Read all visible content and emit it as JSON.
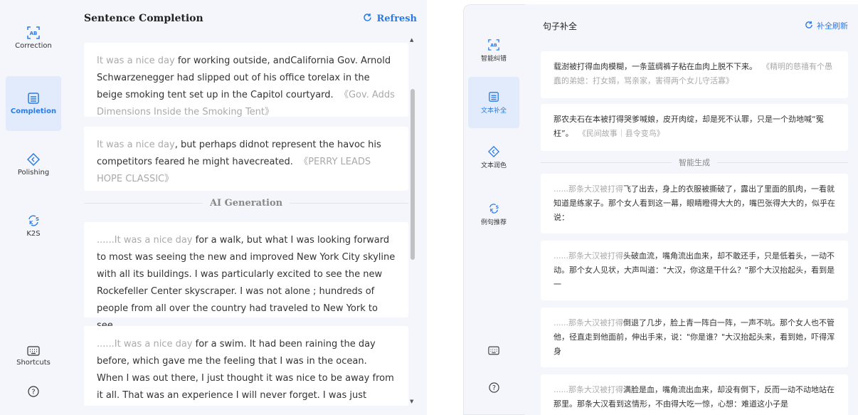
{
  "left": {
    "sidebar": {
      "items": [
        {
          "label": "Correction",
          "icon": "ab-text-icon"
        },
        {
          "label": "Completion",
          "icon": "document-icon"
        },
        {
          "label": "Polishing",
          "icon": "diamond-icon"
        },
        {
          "label": "K2S",
          "icon": "k2s-icon"
        },
        {
          "label": "Shortcuts",
          "icon": "keyboard-icon"
        },
        {
          "label": "",
          "icon": "help-icon"
        }
      ]
    },
    "title": "Sentence Completion",
    "refresh_label": "Refresh",
    "cards": [
      {
        "prefix": "It was a nice day",
        "body": " for working outside, andCalifornia Gov. Arnold Schwarzenegger had slipped out of his office torelax in the beige smoking tent set up in the Capitol courtyard.",
        "source": "《Gov. Adds Dimensions Inside the Smoking Tent》"
      },
      {
        "prefix": "It was a nice day",
        "body": ", but perhaps didnot represent the havoc his competitors feared he might havecreated.",
        "source": "《PERRY LEADS HOPE CLASSIC》"
      }
    ],
    "divider_label": "AI Generation",
    "generated": [
      {
        "prefix": "......It was a nice day",
        "body": " for a walk, but what I was looking forward to most was seeing the new and improved New York City skyline with all its buildings. I was particularly excited to see the new Rockefeller Center skyscraper. I was not alone ; hundreds of people from all over the country had traveled to New York to see"
      },
      {
        "prefix": "......It was a nice day",
        "body": " for a swim. It had been raining the day before, which gave me the feeling that I was in the ocean. When I was out there, I just thought it was nice to be away from it all. That was an experience I will never forget. I was just trying to take it all"
      }
    ]
  },
  "right": {
    "sidebar": {
      "items": [
        {
          "label": "智能纠错",
          "icon": "ab-text-icon"
        },
        {
          "label": "文本补全",
          "icon": "document-icon"
        },
        {
          "label": "文本润色",
          "icon": "diamond-icon"
        },
        {
          "label": "例句推荐",
          "icon": "k2s-icon"
        },
        {
          "label": "",
          "icon": "keyboard-icon"
        },
        {
          "label": "",
          "icon": "help-icon"
        }
      ]
    },
    "title": "句子补全",
    "refresh_label": "补全刷新",
    "cards": [
      {
        "body": "载澍被打得血肉模糊，一条蓝绸裤子粘在血肉上脱不下来。",
        "source": "《精明的慈禧有个愚蠢的弟媳：打女婿，骂亲家，害得两个女儿守活寡》"
      },
      {
        "body": "那农夫石在本被打得哭爹喊娘，皮开肉绽，却是死不认罪，只是一个劲地喊“冤枉”。",
        "source": "《民间故事｜县令变鸟》"
      }
    ],
    "divider_label": "智能生成",
    "generated": [
      {
        "prefix": "......那条大汉被打得",
        "body": "飞了出去，身上的衣服被撕破了，露出了里面的肌肉，一看就知道是练家子。那个女人看到这一幕，眼睛瞪得大大的，嘴巴张得大大的，似乎在说："
      },
      {
        "prefix": "......那条大汉被打得",
        "body": "头破血流，嘴角流出血来，却不敢还手，只是低着头，一动不动。那个女人见状，大声叫道：\"大汉，你这是干什么？\"那个大汉抬起头，看到是一"
      },
      {
        "prefix": "......那条大汉被打得",
        "body": "倒退了几步，脸上青一阵白一阵，一声不吭。那个女人也不管他，径直走到他面前，伸出手来，说：\"你是谁？\"大汉抬起头来，看到她，吓得浑身"
      },
      {
        "prefix": "......那条大汉被打得",
        "body": "满脸是血，嘴角流出血来，却没有倒下，反而一动不动地站在那里。那条大汉看到这情形，不由得大吃一惊，心想：难道这小子是"
      }
    ]
  },
  "colors": {
    "accent": "#2b7be4",
    "panel_bg": "#f4f6fb",
    "active_bg": "#e1ebfb"
  }
}
